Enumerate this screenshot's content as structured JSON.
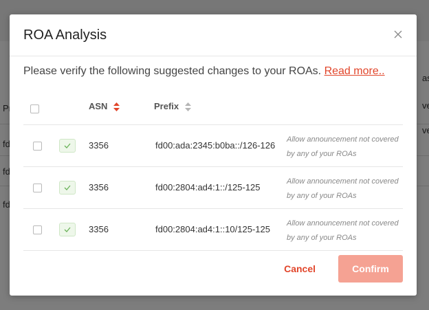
{
  "background": {
    "fragments": [
      "Pr",
      "fd",
      "fd",
      "fd",
      "as",
      "ve",
      "ve"
    ]
  },
  "modal": {
    "title": "ROA Analysis",
    "intro_text": "Please verify the following suggested changes to your ROAs. ",
    "read_more": "Read more..",
    "columns": {
      "asn": "ASN",
      "prefix": "Prefix"
    },
    "rows": [
      {
        "asn": "3356",
        "prefix": "fd00:ada:2345:b0ba::/126-126",
        "note": "Allow announcement not covered by any of your ROAs"
      },
      {
        "asn": "3356",
        "prefix": "fd00:2804:ad4:1::/125-125",
        "note": "Allow announcement not covered by any of your ROAs"
      },
      {
        "asn": "3356",
        "prefix": "fd00:2804:ad4:1::10/125-125",
        "note": "Allow announcement not covered by any of your ROAs"
      }
    ],
    "cancel_label": "Cancel",
    "confirm_label": "Confirm"
  },
  "colors": {
    "accent": "#e1452a",
    "confirm_disabled": "#f5a293",
    "success_badge": "#eef7ea"
  }
}
